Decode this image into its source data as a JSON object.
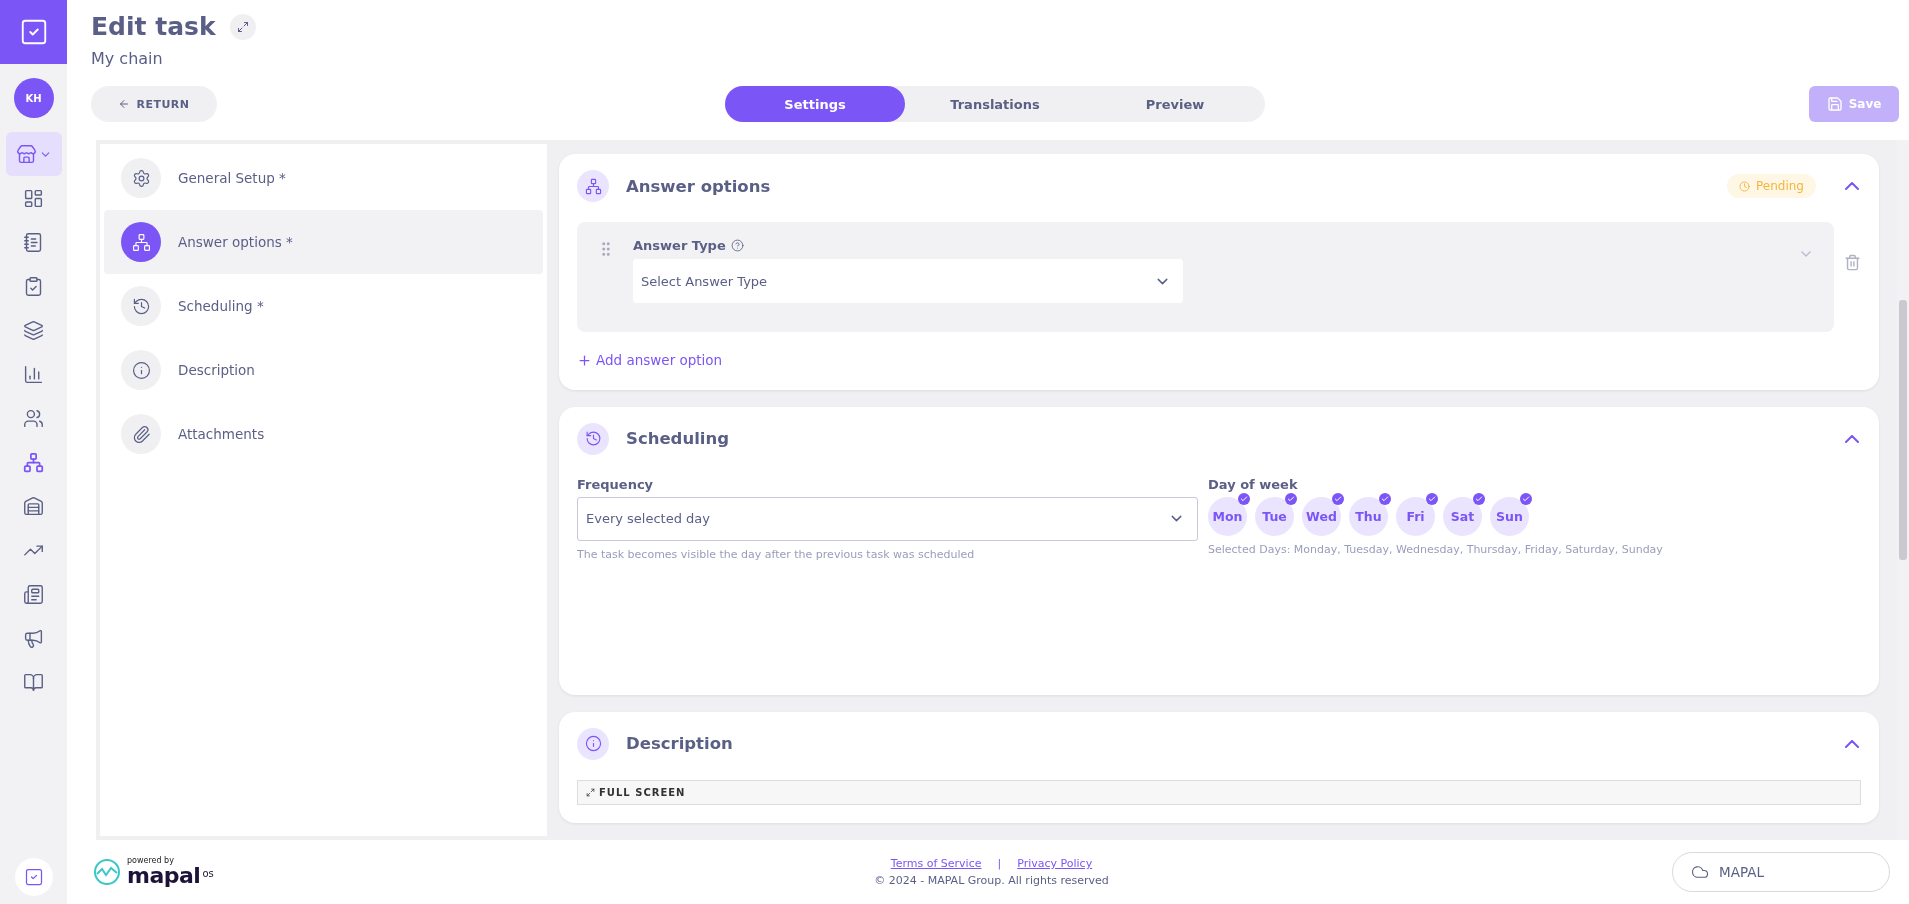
{
  "app_sidebar": {
    "avatar": "KH",
    "nav": [
      {
        "selected": true,
        "current": false
      },
      {
        "selected": false,
        "current": false
      },
      {
        "selected": false,
        "current": false
      },
      {
        "selected": false,
        "current": false
      },
      {
        "selected": false,
        "current": false
      },
      {
        "selected": false,
        "current": false
      },
      {
        "selected": false,
        "current": false
      },
      {
        "selected": false,
        "current": true
      },
      {
        "selected": false,
        "current": false
      },
      {
        "selected": false,
        "current": false
      },
      {
        "selected": false,
        "current": false
      },
      {
        "selected": false,
        "current": false
      },
      {
        "selected": false,
        "current": false
      }
    ]
  },
  "header": {
    "title": "Edit task",
    "subtitle": "My chain"
  },
  "return_button": "RETURN",
  "tabs": [
    {
      "label": "Settings",
      "selected": true
    },
    {
      "label": "Translations",
      "selected": false
    },
    {
      "label": "Preview",
      "selected": false
    }
  ],
  "save_button": {
    "label": "Save",
    "disabled": true
  },
  "steps": [
    {
      "label": "General Setup *",
      "selected": false
    },
    {
      "label": "Answer options *",
      "selected": true
    },
    {
      "label": "Scheduling *",
      "selected": false
    },
    {
      "label": "Description",
      "selected": false
    },
    {
      "label": "Attachments",
      "selected": false
    }
  ],
  "answer_options": {
    "title": "Answer options",
    "status": "Pending",
    "expanded": true,
    "field_label": "Answer Type",
    "select_placeholder": "Select Answer Type",
    "add_link": "Add answer option"
  },
  "scheduling": {
    "title": "Scheduling",
    "expanded": true,
    "frequency_label": "Frequency",
    "frequency_value": "Every selected day",
    "frequency_hint": "The task becomes visible the day after the previous task was scheduled",
    "days_label": "Day of week",
    "days": [
      {
        "label": "Mon",
        "selected": true
      },
      {
        "label": "Tue",
        "selected": true
      },
      {
        "label": "Wed",
        "selected": true
      },
      {
        "label": "Thu",
        "selected": true
      },
      {
        "label": "Fri",
        "selected": true
      },
      {
        "label": "Sat",
        "selected": true
      },
      {
        "label": "Sun",
        "selected": true
      }
    ],
    "days_summary": "Selected Days: Monday, Tuesday, Wednesday, Thursday, Friday, Saturday, Sunday"
  },
  "description": {
    "title": "Description",
    "expanded": true,
    "editor_button": "FULL SCREEN"
  },
  "footer": {
    "powered_by": "powered by",
    "brand": "mapal",
    "brand_suffix": "os",
    "links": [
      "Terms of Service",
      "Privacy Policy"
    ],
    "separator": "|",
    "copyright": "© 2024 - MAPAL Group. All rights reserved",
    "cloud_button": "MAPAL"
  }
}
